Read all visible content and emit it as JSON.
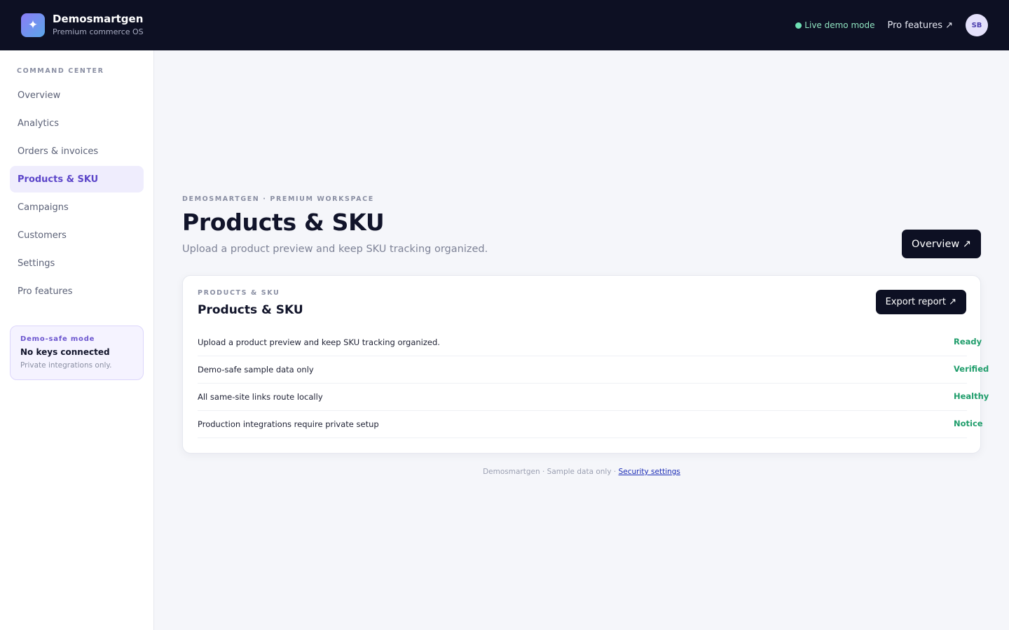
{
  "header": {
    "logo_icon": "sparkle-icon",
    "brand_name": "Demosmartgen",
    "brand_tagline": "Premium commerce OS",
    "live_status": "Live demo mode",
    "pro_link": "Pro features ↗",
    "avatar_initials": "SB"
  },
  "sidebar": {
    "heading": "COMMAND CENTER",
    "items": [
      {
        "label": "Overview",
        "active": false
      },
      {
        "label": "Analytics",
        "active": false
      },
      {
        "label": "Orders & invoices",
        "active": false
      },
      {
        "label": "Products & SKU",
        "active": true
      },
      {
        "label": "Campaigns",
        "active": false
      },
      {
        "label": "Customers",
        "active": false
      },
      {
        "label": "Settings",
        "active": false
      },
      {
        "label": "Pro features",
        "active": false
      }
    ],
    "demo_card": {
      "kicker": "Demo-safe mode",
      "title": "No keys connected",
      "note": "Private integrations only."
    }
  },
  "main": {
    "kicker": "DEMOSMARTGEN · PREMIUM WORKSPACE",
    "title": "Products & SKU",
    "subtitle": "Upload a product preview and keep SKU tracking organized.",
    "overview_button": "Overview ↗",
    "card": {
      "kicker": "PRODUCTS & SKU",
      "title": "Products & SKU",
      "export_button": "Export report ↗",
      "rows": [
        {
          "label": "Upload a product preview and keep SKU tracking organized.",
          "status": "Ready"
        },
        {
          "label": "Demo-safe sample data only",
          "status": "Verified"
        },
        {
          "label": "All same-site links route locally",
          "status": "Healthy"
        },
        {
          "label": "Production integrations require private setup",
          "status": "Notice"
        }
      ]
    },
    "footer": {
      "text": "Demosmartgen · Sample data only · ",
      "link": "Security settings"
    }
  },
  "colors": {
    "topbar": "#0d1023",
    "accent": "#5b45c9",
    "status_green": "#1f9d6b",
    "live_green": "#6ee0b4"
  }
}
